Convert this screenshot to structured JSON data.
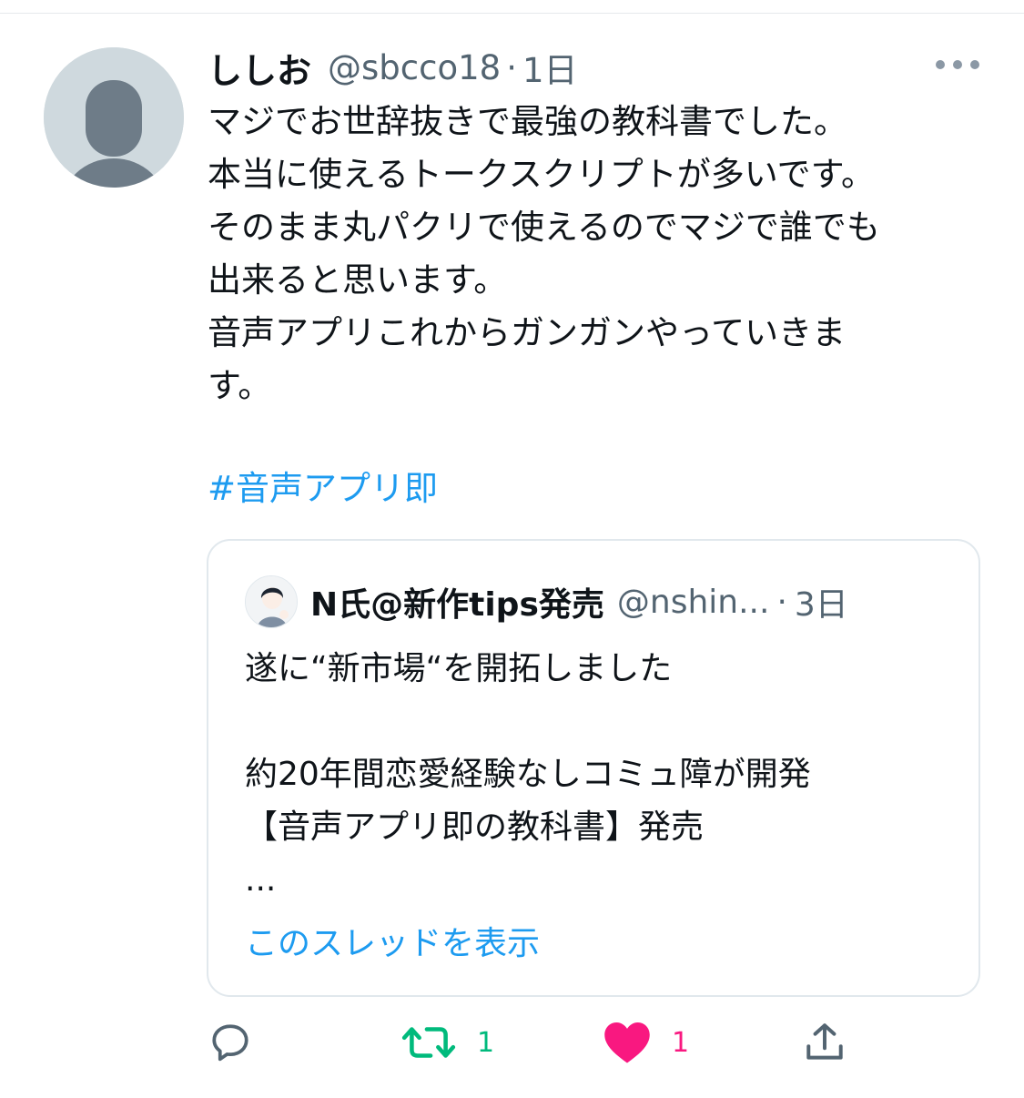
{
  "tweet": {
    "author_name": "ししお",
    "handle": "@sbcco18",
    "separator": "·",
    "time": "1日",
    "text_lines": [
      "マジでお世辞抜きで最強の教科書でした。",
      "本当に使えるトークスクリプトが多いです。",
      "そのまま丸パクリで使えるのでマジで誰でも",
      "出来ると思います。",
      "音声アプリこれからガンガンやっていきま",
      "す。"
    ],
    "hashtag": "#音声アプリ即"
  },
  "quote": {
    "author_name": "N氏@新作tips発売",
    "handle": "@nshin...",
    "separator": "·",
    "time": "3日",
    "text_lines": [
      "遂に“新市場“を開拓しました",
      "",
      "約20年間恋愛経験なしコミュ障が開発",
      "【音声アプリ即の教科書】発売",
      "..."
    ],
    "show_thread": "このスレッドを表示"
  },
  "actions": {
    "reply_icon": "reply-icon",
    "retweet_icon": "retweet-icon",
    "retweet_count": "1",
    "like_icon": "heart-icon",
    "like_count": "1",
    "share_icon": "share-icon"
  },
  "colors": {
    "link": "#1d9bf0",
    "retweet": "#00ba7c",
    "like": "#f91880",
    "secondary_text": "#536471"
  }
}
